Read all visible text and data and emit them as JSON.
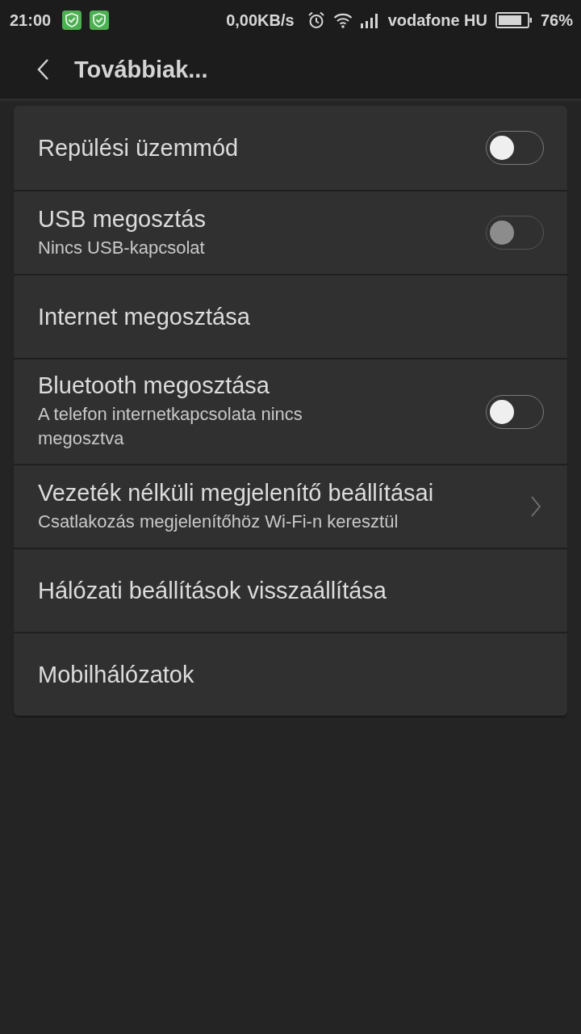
{
  "status_bar": {
    "time": "21:00",
    "speed": "0,00KB/s",
    "carrier": "vodafone HU",
    "battery": "76%"
  },
  "header": {
    "title": "Továbbiak..."
  },
  "settings": [
    {
      "kind": "toggle",
      "title": "Repülési üzemmód",
      "on": false,
      "disabled": false
    },
    {
      "kind": "toggle",
      "title": "USB megosztás",
      "subtitle": "Nincs USB-kapcsolat",
      "on": false,
      "disabled": true
    },
    {
      "kind": "plain",
      "title": "Internet megosztása"
    },
    {
      "kind": "toggle",
      "title": "Bluetooth megosztása",
      "subtitle": "A telefon internetkapcsolata nincs megosztva",
      "on": false,
      "disabled": false
    },
    {
      "kind": "link",
      "title": "Vezeték nélküli megjelenítő beállításai",
      "subtitle": "Csatlakozás megjelenítőhöz Wi-Fi-n keresztül"
    },
    {
      "kind": "plain",
      "title": "Hálózati beállítások visszaállítása"
    },
    {
      "kind": "plain",
      "title": "Mobilhálózatok"
    }
  ]
}
